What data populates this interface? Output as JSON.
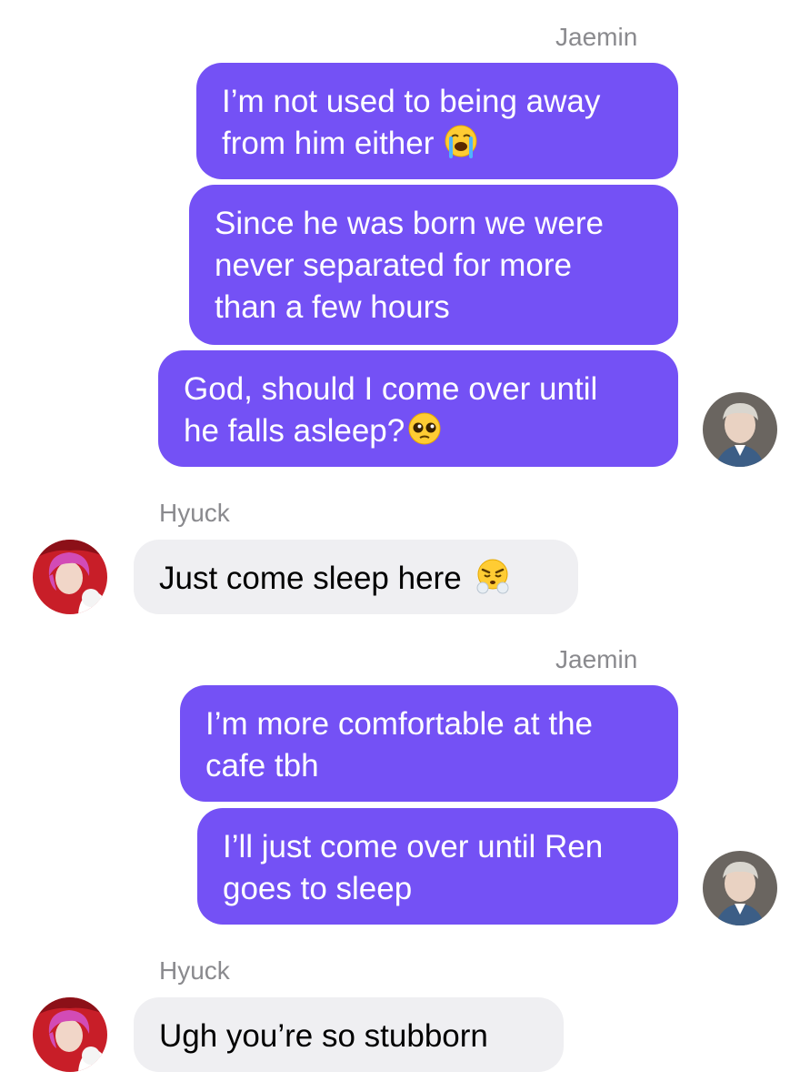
{
  "conversation": {
    "groups": [
      {
        "sender": "Jaemin",
        "messages": [
          {
            "lines": [
              "I’m not used to being away",
              "from him either"
            ],
            "emoji": "loudly-crying-face-emoji"
          },
          {
            "lines": [
              "Since he was born we were",
              "never separated for more",
              "than a few hours"
            ]
          },
          {
            "lines": [
              "God, should I come over until",
              "he falls asleep?"
            ],
            "emoji": "pleading-face-emoji"
          }
        ],
        "avatar": "jaemin-avatar"
      },
      {
        "sender": "Hyuck",
        "messages": [
          {
            "lines": [
              "Just come sleep here"
            ],
            "emoji": "face-with-steam-emoji"
          }
        ],
        "avatar": "hyuck-avatar"
      },
      {
        "sender": "Jaemin",
        "messages": [
          {
            "lines": [
              "I’m more comfortable at the",
              "cafe tbh"
            ]
          },
          {
            "lines": [
              "I’ll just come over until Ren",
              "goes to sleep"
            ]
          }
        ],
        "avatar": "jaemin-avatar"
      },
      {
        "sender": "Hyuck",
        "messages": [
          {
            "lines": [
              "Ugh you’re so stubborn"
            ]
          }
        ],
        "avatar": "hyuck-avatar"
      }
    ]
  },
  "colors": {
    "outgoing_bubble": "#7451f5",
    "incoming_bubble": "#efeff2",
    "sender_name": "#8a8a8e"
  }
}
